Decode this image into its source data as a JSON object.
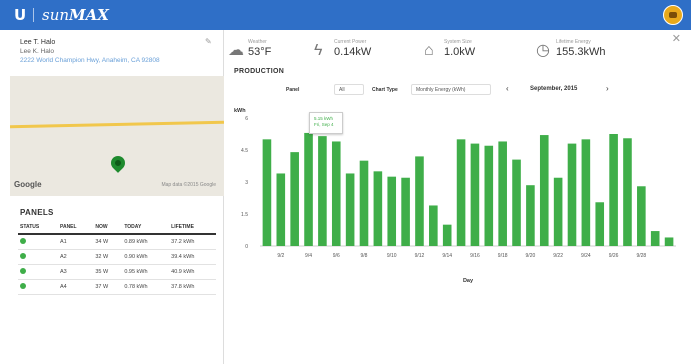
{
  "header": {
    "brand_prefix": "sun",
    "brand_name": "MAX"
  },
  "owner": {
    "name": "Lee T. Halo",
    "sub": "Lee K. Halo",
    "address": "2222 World Champion Hwy, Anaheim, CA 92808"
  },
  "map": {
    "google": "Google",
    "attribution": "Map data ©2015 Google"
  },
  "panels": {
    "title": "PANELS",
    "columns": [
      "STATUS",
      "PANEL",
      "NOW",
      "TODAY",
      "LIFETIME"
    ],
    "rows": [
      {
        "panel": "A1",
        "now": "34 W",
        "today": "0.89 kWh",
        "lifetime": "37.2 kWh"
      },
      {
        "panel": "A2",
        "now": "32 W",
        "today": "0.90 kWh",
        "lifetime": "39.4 kWh"
      },
      {
        "panel": "A3",
        "now": "35 W",
        "today": "0.95 kWh",
        "lifetime": "40.9 kWh"
      },
      {
        "panel": "A4",
        "now": "37 W",
        "today": "0.78 kWh",
        "lifetime": "37.8 kWh"
      }
    ]
  },
  "stats": {
    "weather_label": "Weather",
    "weather_value": "53°F",
    "power_label": "Current Power",
    "power_value": "0.14kW",
    "system_label": "System Size",
    "system_value": "1.0kW",
    "lifetime_label": "Lifetime Energy",
    "lifetime_value": "155.3kWh"
  },
  "production": {
    "title": "PRODUCTION",
    "panel_label": "Panel",
    "panel_value": "All",
    "chart_type_label": "Chart Type",
    "chart_type_value": "Monthly Energy (kWh)",
    "month": "September, 2015",
    "tooltip_value": "5.15 kWh",
    "tooltip_date": "Fri, Sep 4"
  },
  "chart_data": {
    "type": "bar",
    "ylabel": "kWh",
    "xlabel": "Day",
    "ylim": [
      0,
      6
    ],
    "yticks": [
      0,
      1.5,
      3,
      4.5,
      6
    ],
    "categories": [
      "9/1",
      "9/2",
      "9/3",
      "9/4",
      "9/5",
      "9/6",
      "9/7",
      "9/8",
      "9/9",
      "9/10",
      "9/11",
      "9/12",
      "9/13",
      "9/14",
      "9/15",
      "9/16",
      "9/17",
      "9/18",
      "9/19",
      "9/20",
      "9/21",
      "9/22",
      "9/23",
      "9/24",
      "9/25",
      "9/26",
      "9/27",
      "9/28",
      "9/29",
      "9/30"
    ],
    "tick_labels": [
      "9/2",
      "9/4",
      "9/6",
      "9/8",
      "9/10",
      "9/12",
      "9/14",
      "9/16",
      "9/18",
      "9/20",
      "9/22",
      "9/24",
      "9/26",
      "9/28"
    ],
    "values": [
      5.0,
      3.4,
      4.4,
      5.3,
      5.15,
      4.9,
      3.4,
      4.0,
      3.5,
      3.25,
      3.2,
      4.2,
      1.9,
      1.0,
      5.0,
      4.8,
      4.7,
      4.9,
      4.05,
      2.85,
      5.2,
      3.2,
      4.8,
      5.0,
      2.05,
      5.25,
      5.05,
      2.8,
      0.7,
      0.4
    ],
    "color": "#3fae49",
    "grid": false
  }
}
